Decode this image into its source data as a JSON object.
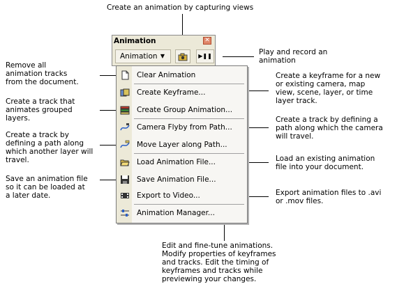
{
  "callouts": {
    "capture_views": "Create an animation by capturing views",
    "play_record": "Play and record an\nanimation",
    "remove_tracks": "Remove all\nanimation tracks\nfrom the document.",
    "create_keyframe": "Create a keyframe for a new\nor existing camera, map\nview, scene, layer, or time\nlayer track.",
    "grouped_layers": "Create a track that\nanimates grouped\nlayers.",
    "camera_path": "Create a track by defining a\npath along which the camera\nwill travel.",
    "layer_path": "Create a track by\ndefining a path along\nwhich another layer will\ntravel.",
    "load_file": "Load an existing animation\nfile into your document.",
    "save_file": "Save an animation file\nso it can be loaded at\na later date.",
    "export_video": "Export animation files to .avi\nor .mov files.",
    "manager": "Edit and fine-tune animations.\nModify properties of keyframes\nand tracks. Edit the timing of\nkeyframes and tracks while\npreviewing your changes."
  },
  "toolbar": {
    "title": "Animation",
    "close_glyph": "✕",
    "menu_button_label": "Animation",
    "dropdown_arrow": "▼",
    "play_glyph": "▶❚❚"
  },
  "menu": {
    "items": [
      {
        "label": "Clear Animation",
        "icon": "clear-animation-icon"
      },
      {
        "label": "Create Keyframe...",
        "icon": "create-keyframe-icon"
      },
      {
        "label": "Create Group Animation...",
        "icon": "group-animation-icon"
      },
      {
        "label": "Camera Flyby from Path...",
        "icon": "camera-flyby-icon"
      },
      {
        "label": "Move Layer along Path...",
        "icon": "move-layer-icon"
      },
      {
        "label": "Load Animation File...",
        "icon": "load-file-icon"
      },
      {
        "label": "Save Animation File...",
        "icon": "save-file-icon"
      },
      {
        "label": "Export to Video...",
        "icon": "export-video-icon"
      },
      {
        "label": "Animation Manager...",
        "icon": "animation-manager-icon"
      }
    ]
  }
}
